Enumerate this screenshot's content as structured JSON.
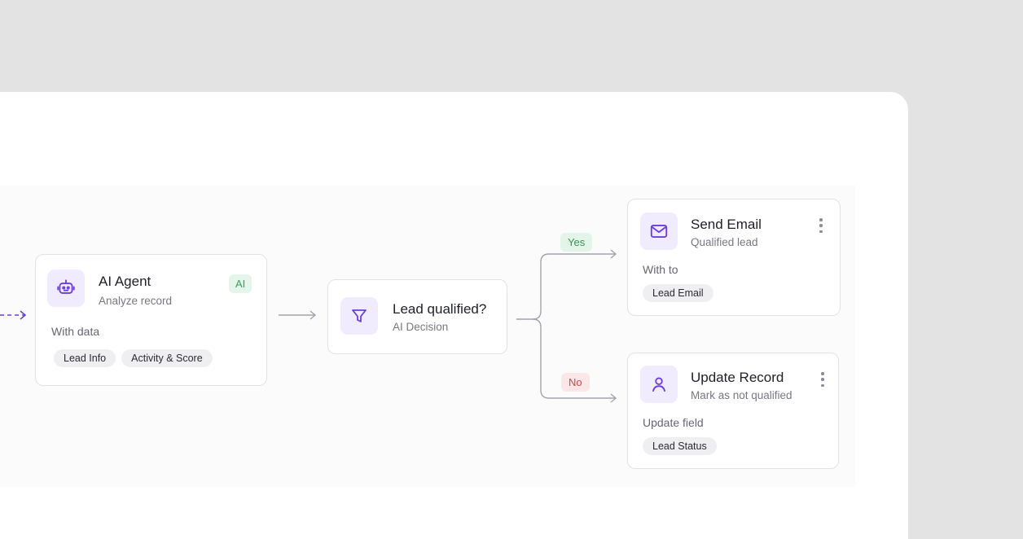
{
  "nodes": {
    "ai_agent": {
      "title": "AI Agent",
      "subtitle": "Analyze record",
      "badge": "AI",
      "section_label": "With data",
      "chips": [
        "Lead Info",
        "Activity & Score"
      ],
      "icon": "robot-icon"
    },
    "decision": {
      "title": "Lead qualified?",
      "subtitle": "AI Decision",
      "icon": "filter-icon"
    },
    "send_email": {
      "title": "Send Email",
      "subtitle": "Qualified lead",
      "section_label": "With to",
      "chips": [
        "Lead Email"
      ],
      "icon": "mail-icon"
    },
    "update_record": {
      "title": "Update Record",
      "subtitle": "Mark as not qualified",
      "section_label": "Update field",
      "chips": [
        "Lead Status"
      ],
      "icon": "user-icon"
    }
  },
  "branches": {
    "yes": "Yes",
    "no": "No"
  },
  "colors": {
    "accent": "#6a3ee0",
    "yes": "#3d8f5a",
    "no": "#cc4a4a",
    "connector": "#a3a3ad"
  }
}
